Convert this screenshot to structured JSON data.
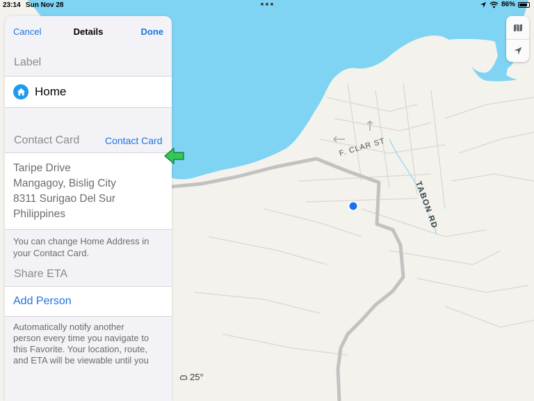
{
  "status_bar": {
    "time": "23:14",
    "date": "Sun Nov 28",
    "battery": "86%",
    "battery_level": 0.86
  },
  "panel": {
    "nav": {
      "cancel": "Cancel",
      "title": "Details",
      "done": "Done"
    },
    "label_section": {
      "header": "Label",
      "value": "Home",
      "icon": "house-icon"
    },
    "contact_section": {
      "header": "Contact Card",
      "link": "Contact Card",
      "address_lines": [
        "Taripe Drive",
        "Mangagoy, Bislig City",
        "8311 Surigao Del Sur",
        "Philippines"
      ],
      "note_line1": "You can change Home Address in",
      "note_line2": "your Contact Card."
    },
    "share_section": {
      "header": "Share ETA",
      "add_person": "Add Person",
      "note_lines": [
        "Automatically notify another",
        "person every time you navigate to",
        "this Favorite. Your location, route,",
        "and ETA will be viewable until you"
      ]
    }
  },
  "map": {
    "street_labels": {
      "clar": "F. CLAR ST",
      "tabon": "TABON RD"
    },
    "weather": "25°",
    "colors": {
      "water": "#7fd3f3",
      "land": "#f4f2ec",
      "road": "#c2c2c2",
      "accent": "#1d74e0",
      "location": "#1a73e8",
      "annotation": "#34c759"
    }
  }
}
